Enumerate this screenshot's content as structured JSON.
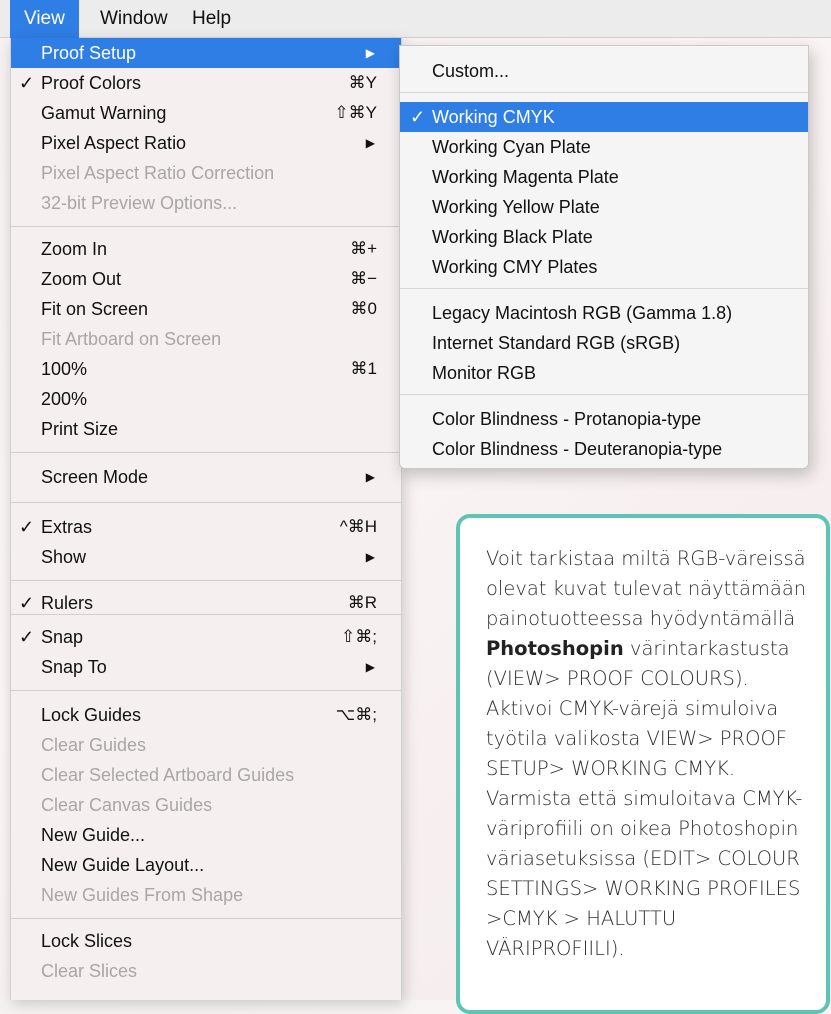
{
  "menubar": {
    "items": [
      "View",
      "Window",
      "Help"
    ]
  },
  "view_menu": {
    "items": [
      {
        "label": "Proof Setup",
        "shortcut": "",
        "check": "",
        "arrow": "▶",
        "state": "highlighted"
      },
      {
        "label": "Proof Colors",
        "shortcut": "⌘Y",
        "check": "✓",
        "arrow": "",
        "state": "normal"
      },
      {
        "label": "Gamut Warning",
        "shortcut": "⇧⌘Y",
        "check": "",
        "arrow": "",
        "state": "normal"
      },
      {
        "label": "Pixel Aspect Ratio",
        "shortcut": "",
        "check": "",
        "arrow": "▶",
        "state": "normal"
      },
      {
        "label": "Pixel Aspect Ratio Correction",
        "shortcut": "",
        "check": "",
        "arrow": "",
        "state": "disabled"
      },
      {
        "label": "32-bit Preview Options...",
        "shortcut": "",
        "check": "",
        "arrow": "",
        "state": "disabled"
      },
      {
        "label": "Zoom In",
        "shortcut": "⌘+",
        "check": "",
        "arrow": "",
        "state": "normal"
      },
      {
        "label": "Zoom Out",
        "shortcut": "⌘−",
        "check": "",
        "arrow": "",
        "state": "normal"
      },
      {
        "label": "Fit on Screen",
        "shortcut": "⌘0",
        "check": "",
        "arrow": "",
        "state": "normal"
      },
      {
        "label": "Fit Artboard on Screen",
        "shortcut": "",
        "check": "",
        "arrow": "",
        "state": "disabled"
      },
      {
        "label": "100%",
        "shortcut": "⌘1",
        "check": "",
        "arrow": "",
        "state": "normal"
      },
      {
        "label": "200%",
        "shortcut": "",
        "check": "",
        "arrow": "",
        "state": "normal"
      },
      {
        "label": "Print Size",
        "shortcut": "",
        "check": "",
        "arrow": "",
        "state": "normal"
      },
      {
        "label": "Screen Mode",
        "shortcut": "",
        "check": "",
        "arrow": "▶",
        "state": "normal"
      },
      {
        "label": "Extras",
        "shortcut": "^⌘H",
        "check": "✓",
        "arrow": "",
        "state": "normal"
      },
      {
        "label": "Show",
        "shortcut": "",
        "check": "",
        "arrow": "▶",
        "state": "normal"
      },
      {
        "label": "Rulers",
        "shortcut": "⌘R",
        "check": "✓",
        "arrow": "",
        "state": "normal"
      },
      {
        "label": "Snap",
        "shortcut": "⇧⌘;",
        "check": "✓",
        "arrow": "",
        "state": "normal"
      },
      {
        "label": "Snap To",
        "shortcut": "",
        "check": "",
        "arrow": "▶",
        "state": "normal"
      },
      {
        "label": "Lock Guides",
        "shortcut": "⌥⌘;",
        "check": "",
        "arrow": "",
        "state": "normal"
      },
      {
        "label": "Clear Guides",
        "shortcut": "",
        "check": "",
        "arrow": "",
        "state": "disabled"
      },
      {
        "label": "Clear Selected Artboard Guides",
        "shortcut": "",
        "check": "",
        "arrow": "",
        "state": "disabled"
      },
      {
        "label": "Clear Canvas Guides",
        "shortcut": "",
        "check": "",
        "arrow": "",
        "state": "disabled"
      },
      {
        "label": "New Guide...",
        "shortcut": "",
        "check": "",
        "arrow": "",
        "state": "normal"
      },
      {
        "label": "New Guide Layout...",
        "shortcut": "",
        "check": "",
        "arrow": "",
        "state": "normal"
      },
      {
        "label": "New Guides From Shape",
        "shortcut": "",
        "check": "",
        "arrow": "",
        "state": "disabled"
      },
      {
        "label": "Lock Slices",
        "shortcut": "",
        "check": "",
        "arrow": "",
        "state": "normal"
      },
      {
        "label": "Clear Slices",
        "shortcut": "",
        "check": "",
        "arrow": "",
        "state": "disabled"
      }
    ]
  },
  "proof_submenu": {
    "items": [
      {
        "label": "Custom...",
        "check": "",
        "state": "normal"
      },
      {
        "label": "Working CMYK",
        "check": "✓",
        "state": "highlighted"
      },
      {
        "label": "Working Cyan Plate",
        "check": "",
        "state": "normal"
      },
      {
        "label": "Working Magenta Plate",
        "check": "",
        "state": "normal"
      },
      {
        "label": "Working Yellow Plate",
        "check": "",
        "state": "normal"
      },
      {
        "label": "Working Black Plate",
        "check": "",
        "state": "normal"
      },
      {
        "label": "Working CMY Plates",
        "check": "",
        "state": "normal"
      },
      {
        "label": "Legacy Macintosh RGB (Gamma 1.8)",
        "check": "",
        "state": "normal"
      },
      {
        "label": "Internet Standard RGB (sRGB)",
        "check": "",
        "state": "normal"
      },
      {
        "label": "Monitor RGB",
        "check": "",
        "state": "normal"
      },
      {
        "label": "Color Blindness - Protanopia-type",
        "check": "",
        "state": "normal"
      },
      {
        "label": "Color Blindness - Deuteranopia-type",
        "check": "",
        "state": "normal"
      }
    ]
  },
  "callout": {
    "text_before": "Voit tarkistaa miltä RGB-väreissä olevat kuvat tulevat näyttämään painotuotteessa hyödyntämällä ",
    "bold": "Photoshopin",
    "text_after": " värintarkastusta (VIEW> PROOF COLOURS). Aktivoi CMYK-värejä simuloiva työtila valikosta VIEW> PROOF SETUP> WORKING CMYK. Varmista että simuloitava CMYK-väriprofiili on oikea Photoshopin väriasetuksissa (EDIT> COLOUR SETTINGS> WORKING PROFILES >CMYK > HALUTTU VÄRIPROFIILI)."
  },
  "colors": {
    "highlight": "#2f7ee6",
    "callout_border": "#5ec5b6",
    "disabled_text": "#a9a6a6"
  }
}
